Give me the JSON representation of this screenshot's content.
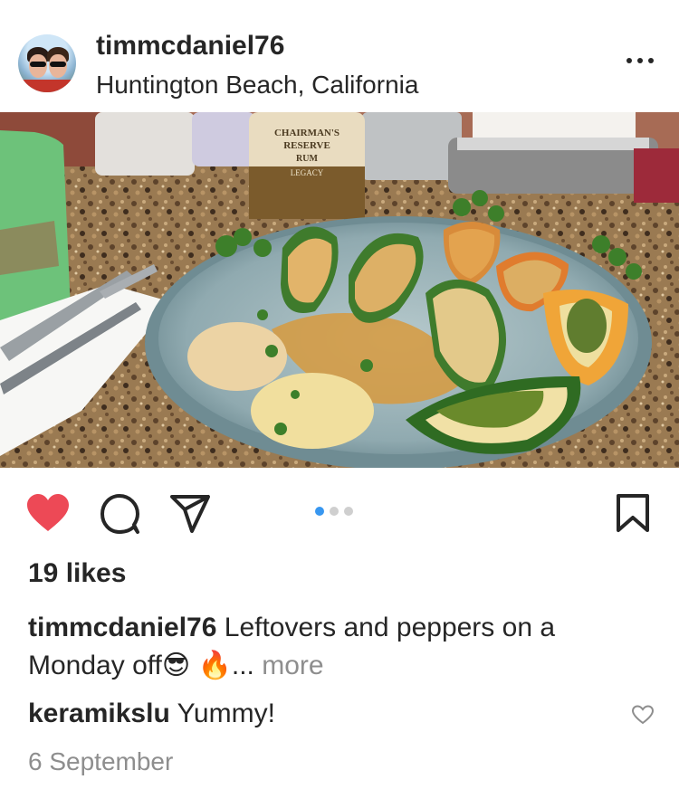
{
  "post": {
    "username": "timmcdaniel76",
    "location": "Huntington Beach, California",
    "likes": "19 likes",
    "caption_user": "timmcdaniel76",
    "caption_text": "Leftovers and peppers on a Monday off",
    "caption_emoji_1": "😎",
    "caption_emoji_2": "🔥",
    "caption_ellipsis": "...",
    "caption_more": "more",
    "comment_user": "keramikslu",
    "comment_text": "Yummy!",
    "date": "6 September"
  },
  "photo_label": {
    "bottle_line1": "CHAIRMAN'S",
    "bottle_line2": "RESERVE",
    "bottle_line3": "RUM",
    "bottle_line4": "LEGACY"
  },
  "carousel": {
    "count": 3,
    "active_index": 0
  },
  "icons": [
    "heart-icon",
    "comment-icon",
    "share-icon",
    "bookmark-icon",
    "more-options-icon",
    "comment-like-icon"
  ],
  "colors": {
    "like_red": "#ed4956",
    "carousel_active": "#3897f0",
    "muted_text": "#8e8e8e"
  }
}
